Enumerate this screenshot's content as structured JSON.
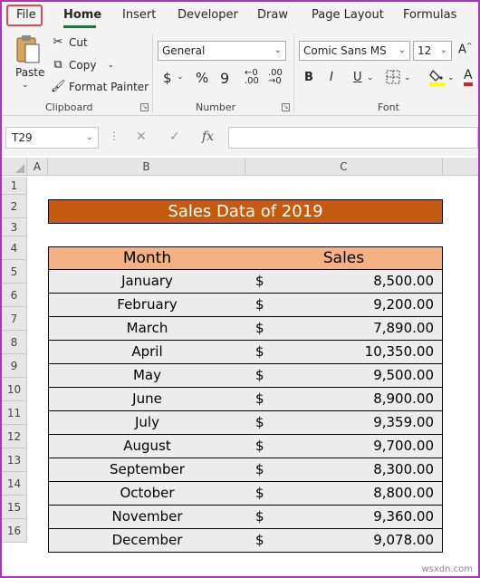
{
  "ribbon": {
    "tabs": [
      "File",
      "Home",
      "Insert",
      "Developer",
      "Draw",
      "Page Layout",
      "Formulas"
    ],
    "clipboard": {
      "paste_label": "Paste",
      "cut_label": "Cut",
      "copy_label": "Copy",
      "format_painter_label": "Format Painter",
      "group_label": "Clipboard"
    },
    "number": {
      "format_value": "General",
      "group_label": "Number"
    },
    "font": {
      "font_name": "Comic Sans MS",
      "font_size": "12",
      "bold": "B",
      "italic": "I",
      "underline": "U",
      "font_color_label": "A",
      "group_label": "Font"
    },
    "accent_color": "#217346",
    "highlight_box_color": "#e0455a"
  },
  "formula_bar": {
    "name_box": "T29",
    "fx_label": "fx",
    "content": ""
  },
  "grid": {
    "columns": [
      "A",
      "B",
      "C"
    ],
    "rows": [
      "1",
      "2",
      "3",
      "4",
      "5",
      "6",
      "7",
      "8",
      "9",
      "10",
      "11",
      "12",
      "13",
      "14",
      "15",
      "16"
    ]
  },
  "sheet": {
    "title": "Sales Data of 2019",
    "title_fill": "#c55a11",
    "header_fill": "#f4b183",
    "headers": {
      "month": "Month",
      "sales": "Sales"
    },
    "currency_symbol": "$",
    "rows": [
      {
        "month": "January",
        "sales": "8,500.00"
      },
      {
        "month": "February",
        "sales": "9,200.00"
      },
      {
        "month": "March",
        "sales": "7,890.00"
      },
      {
        "month": "April",
        "sales": "10,350.00"
      },
      {
        "month": "May",
        "sales": "9,500.00"
      },
      {
        "month": "June",
        "sales": "8,900.00"
      },
      {
        "month": "July",
        "sales": "9,359.00"
      },
      {
        "month": "August",
        "sales": "9,700.00"
      },
      {
        "month": "September",
        "sales": "8,300.00"
      },
      {
        "month": "October",
        "sales": "8,800.00"
      },
      {
        "month": "November",
        "sales": "9,360.00"
      },
      {
        "month": "December",
        "sales": "9,078.00"
      }
    ]
  },
  "watermark": "wsxdn.com"
}
